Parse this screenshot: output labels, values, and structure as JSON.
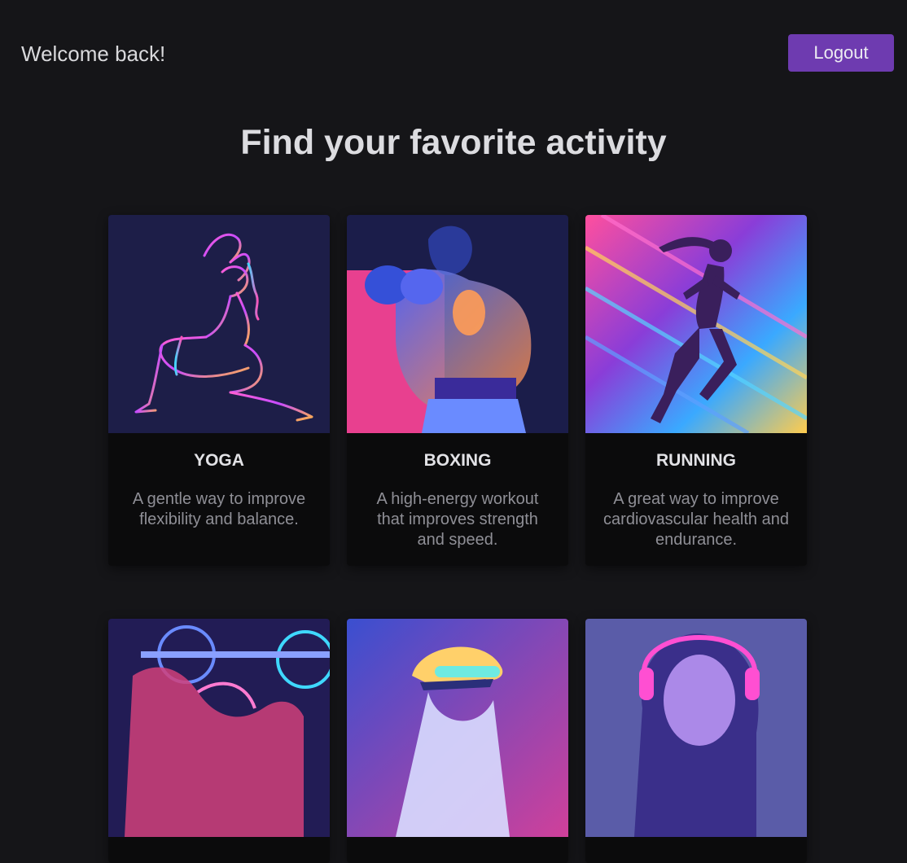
{
  "header": {
    "welcome": "Welcome back!",
    "logout_label": "Logout"
  },
  "main": {
    "title": "Find your favorite activity",
    "activities": [
      {
        "name": "YOGA",
        "description": "A gentle way to improve flexibility and balance.",
        "image_icon": "yoga-illustration"
      },
      {
        "name": "BOXING",
        "description": "A high-energy workout that improves strength and speed.",
        "image_icon": "boxing-illustration"
      },
      {
        "name": "RUNNING",
        "description": "A great way to improve cardiovascular health and endurance.",
        "image_icon": "running-illustration"
      },
      {
        "name": "",
        "description": "",
        "image_icon": "weightlifting-illustration"
      },
      {
        "name": "",
        "description": "",
        "image_icon": "cycling-illustration"
      },
      {
        "name": "",
        "description": "",
        "image_icon": "music-meditation-illustration"
      }
    ]
  },
  "colors": {
    "background": "#151518",
    "card": "#0b0b0c",
    "accent": "#6e3bb0"
  }
}
